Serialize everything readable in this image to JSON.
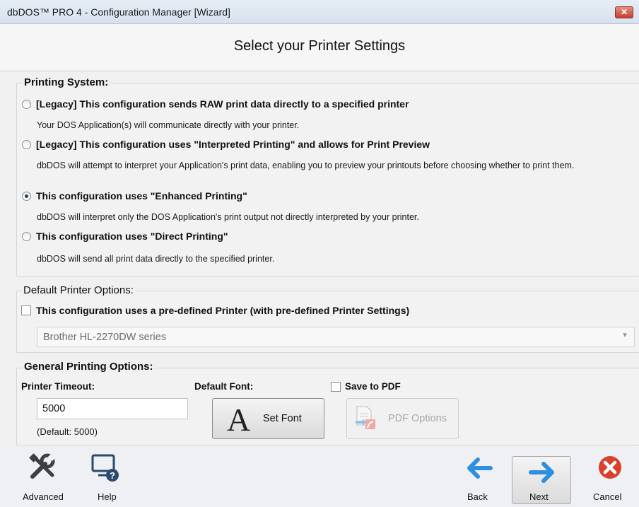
{
  "window": {
    "title": "dbDOS™ PRO 4 - Configuration Manager [Wizard]",
    "close_glyph": "✕"
  },
  "header": {
    "title": "Select your Printer Settings"
  },
  "printing_system": {
    "legend": "Printing System:",
    "options": [
      {
        "label": "[Legacy] This configuration sends RAW print data directly to a specified printer",
        "description": "Your DOS Application(s) will communicate directly with your printer.",
        "selected": false
      },
      {
        "label": "[Legacy] This configuration uses \"Interpreted Printing\" and allows for Print Preview",
        "description": "dbDOS will attempt to interpret your Application's print data, enabling you to preview your printouts before choosing whether to print them.",
        "selected": false
      },
      {
        "label": "This configuration uses \"Enhanced Printing\"",
        "description": "dbDOS will interpret only the DOS Application's print output not directly interpreted by your printer.",
        "selected": true
      },
      {
        "label": "This configuration uses \"Direct Printing\"",
        "description": "dbDOS will send all print data directly to the specified printer.",
        "selected": false
      }
    ]
  },
  "default_printer": {
    "legend": "Default Printer Options:",
    "checkbox_label": "This configuration uses a pre-defined Printer (with pre-defined Printer Settings)",
    "checked": false,
    "printer_select_value": "Brother HL-2270DW series",
    "arrow_glyph": "▼"
  },
  "general": {
    "legend": "General Printing Options:",
    "timeout_label": "Printer Timeout:",
    "timeout_value": "5000",
    "timeout_default": "(Default: 5000)",
    "font_label": "Default Font:",
    "set_font_button": "Set Font",
    "font_glyph": "A",
    "save_pdf_label": "Save to PDF",
    "save_pdf_checked": false,
    "pdf_options_button": "PDF Options"
  },
  "footer": {
    "advanced": "Advanced",
    "help": "Help",
    "back": "Back",
    "next": "Next",
    "cancel": "Cancel"
  },
  "colors": {
    "accent_blue": "#2e8ee0",
    "cancel_red": "#d9412d",
    "selected_radio": "#233d72"
  },
  "icons": [
    "close-icon",
    "tools-icon",
    "help-icon",
    "back-arrow-icon",
    "next-arrow-icon",
    "cancel-icon",
    "font-icon",
    "pdf-icon",
    "dropdown-arrow-icon"
  ]
}
